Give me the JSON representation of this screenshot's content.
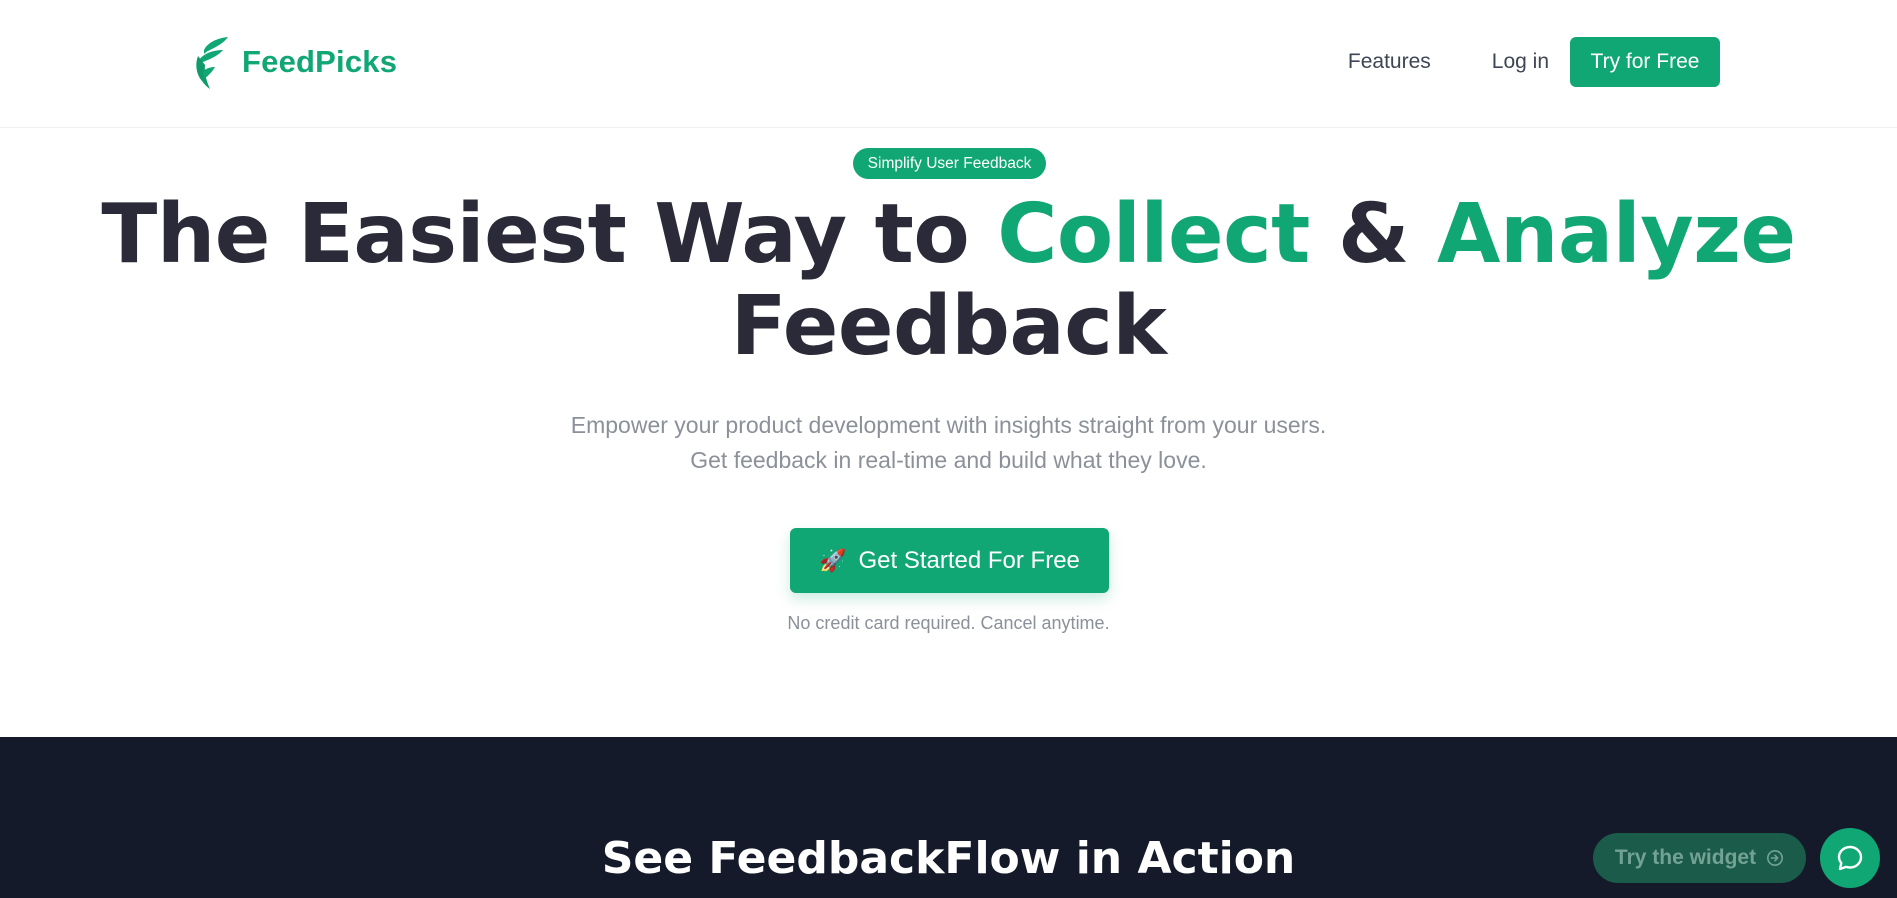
{
  "brand": {
    "name": "FeedPicks",
    "color": "#10a774"
  },
  "nav": {
    "features": "Features",
    "login": "Log in",
    "try_free": "Try for Free"
  },
  "hero": {
    "badge": "Simplify User Feedback",
    "headline": {
      "part1": "The Easiest Way to ",
      "accent1": "Collect",
      "part2": " & ",
      "accent2": "Analyze",
      "line2": "Feedback"
    },
    "subtitle_line1": "Empower your product development with insights straight from your users.",
    "subtitle_line2": "Get feedback in real-time and build what they love.",
    "cta_icon": "rocket-icon",
    "cta_label": "Get Started For Free",
    "cta_note": "No credit card required. Cancel anytime."
  },
  "showcase": {
    "title": "See FeedbackFlow in Action"
  },
  "widget": {
    "try_label": "Try the widget",
    "try_icon": "arrow-right-circle-icon",
    "chat_icon": "chat-bubble-icon"
  },
  "colors": {
    "accent": "#10a774",
    "dark_bg": "#141a29",
    "heading": "#2b2a38",
    "muted": "#8b9099"
  }
}
